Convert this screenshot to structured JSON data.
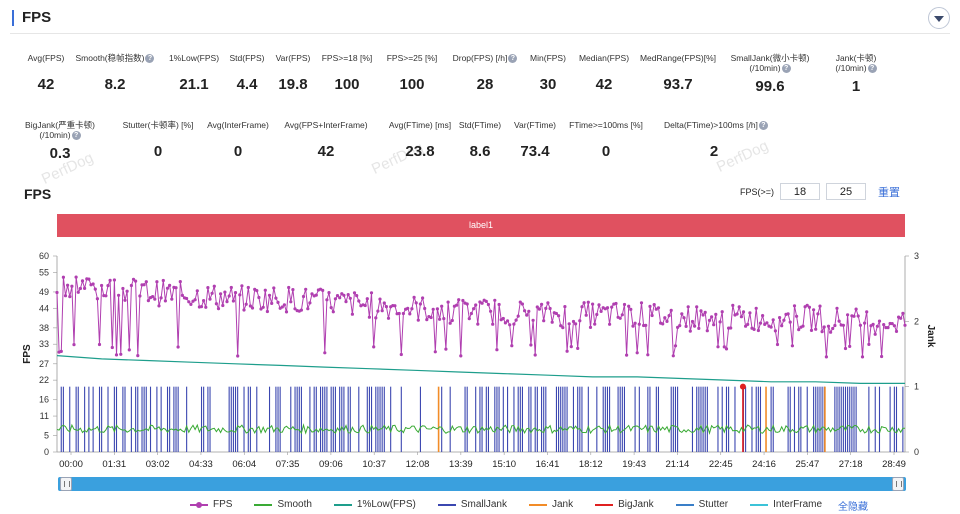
{
  "header": {
    "title": "FPS"
  },
  "stats_row1": [
    {
      "label": "Avg(FPS)",
      "value": "42",
      "help": false
    },
    {
      "label": "Smooth(稳帧指数)",
      "value": "8.2",
      "help": true
    },
    {
      "label": "1%Low(FPS)",
      "value": "21.1",
      "help": false
    },
    {
      "label": "Std(FPS)",
      "value": "4.4",
      "help": false
    },
    {
      "label": "Var(FPS)",
      "value": "19.8",
      "help": false
    },
    {
      "label": "FPS>=18 [%]",
      "value": "100",
      "help": false
    },
    {
      "label": "FPS>=25 [%]",
      "value": "100",
      "help": false
    },
    {
      "label": "Drop(FPS) [/h]",
      "value": "28",
      "help": true
    },
    {
      "label": "Min(FPS)",
      "value": "30",
      "help": false
    },
    {
      "label": "Median(FPS)",
      "value": "42",
      "help": false
    },
    {
      "label": "MedRange(FPS)[%]",
      "value": "93.7",
      "help": false
    },
    {
      "label": "SmallJank(微小卡顿)",
      "label2": "(/10min)",
      "value": "99.6",
      "help": true
    },
    {
      "label": "Jank(卡顿)",
      "label2": "(/10min)",
      "value": "1",
      "help": true
    }
  ],
  "stats_row2": [
    {
      "label": "BigJank(严重卡顿)",
      "label2": "(/10min)",
      "value": "0.3",
      "help": true
    },
    {
      "label": "Stutter(卡顿率) [%]",
      "value": "0",
      "help": false
    },
    {
      "label": "Avg(InterFrame)",
      "value": "0",
      "help": false
    },
    {
      "label": "Avg(FPS+InterFrame)",
      "value": "42",
      "help": false
    },
    {
      "label": "Avg(FTime) [ms]",
      "value": "23.8",
      "help": false
    },
    {
      "label": "Std(FTime)",
      "value": "8.6",
      "help": false
    },
    {
      "label": "Var(FTime)",
      "value": "73.4",
      "help": false
    },
    {
      "label": "FTime>=100ms [%]",
      "value": "0",
      "help": false
    },
    {
      "label": "Delta(FTime)>100ms [/h]",
      "value": "2",
      "help": true
    }
  ],
  "watermark": "PerfDog",
  "chart_title": "FPS",
  "filter": {
    "label": "FPS(>=)",
    "value1": "18",
    "value2": "25",
    "reset": "重置"
  },
  "label_band": "label1",
  "legend_hide_all": "全隐藏",
  "colors": {
    "fps": "#b03fb0",
    "smooth": "#3aaa35",
    "low1": "#1e9e8c",
    "smalljank": "#3b47b0",
    "jank": "#f28c28",
    "bigjank": "#e02020",
    "stutter": "#3a7fc8",
    "interframe": "#3cc3d8"
  },
  "chart_data": {
    "type": "line",
    "title": "FPS",
    "ylabel": "FPS",
    "y2label": "Jank",
    "ylim": [
      0,
      60
    ],
    "y2lim": [
      0,
      3
    ],
    "yticks": [
      0,
      5,
      11,
      16,
      22,
      27,
      33,
      38,
      44,
      49,
      55,
      60
    ],
    "y2ticks": [
      0,
      1,
      2,
      3
    ],
    "xticks": [
      "00:00",
      "01:31",
      "03:02",
      "04:33",
      "06:04",
      "07:35",
      "09:06",
      "10:37",
      "12:08",
      "13:39",
      "15:10",
      "16:41",
      "18:12",
      "19:43",
      "21:14",
      "22:45",
      "24:16",
      "25:47",
      "27:18",
      "28:49"
    ],
    "duration_s": 1800,
    "series": [
      {
        "name": "FPS",
        "summary": {
          "start_mean": 50,
          "end_mean": 40,
          "min": 30,
          "avg": 42
        },
        "values": [
          52,
          50,
          49,
          48,
          47,
          47,
          46,
          45,
          44,
          43,
          43,
          42,
          42,
          42,
          41,
          41,
          41,
          41,
          40,
          40
        ]
      },
      {
        "name": "Smooth",
        "values": [
          7,
          7,
          7,
          7,
          7,
          7,
          7,
          7,
          7,
          7,
          7,
          7,
          7,
          7,
          7,
          7,
          7,
          7,
          7,
          7
        ]
      },
      {
        "name": "1%Low(FPS)",
        "values": [
          29.5,
          28.5,
          28,
          27.5,
          27,
          26.5,
          26,
          25.5,
          25,
          24.5,
          24,
          23.5,
          23,
          23,
          22.5,
          22,
          21.5,
          21.5,
          21,
          21
        ]
      },
      {
        "name": "SmallJank",
        "axis": "right",
        "note": "frequent 0/1 spikes"
      },
      {
        "name": "Jank",
        "axis": "right",
        "events_at": [
          "13:30",
          "25:05",
          "27:10"
        ]
      },
      {
        "name": "BigJank",
        "axis": "right",
        "events_at": [
          "24:16"
        ]
      },
      {
        "name": "Stutter",
        "axis": "right",
        "values": []
      },
      {
        "name": "InterFrame",
        "axis": "right",
        "values": []
      }
    ],
    "legend": [
      {
        "name": "FPS",
        "color": "#b03fb0",
        "marker": true
      },
      {
        "name": "Smooth",
        "color": "#3aaa35",
        "marker": false
      },
      {
        "name": "1%Low(FPS)",
        "color": "#1e9e8c",
        "marker": false
      },
      {
        "name": "SmallJank",
        "color": "#3b47b0",
        "marker": false
      },
      {
        "name": "Jank",
        "color": "#f28c28",
        "marker": false
      },
      {
        "name": "BigJank",
        "color": "#e02020",
        "marker": false
      },
      {
        "name": "Stutter",
        "color": "#3a7fc8",
        "marker": false
      },
      {
        "name": "InterFrame",
        "color": "#3cc3d8",
        "marker": false
      }
    ],
    "legend_position": "bottom",
    "grid": true
  }
}
